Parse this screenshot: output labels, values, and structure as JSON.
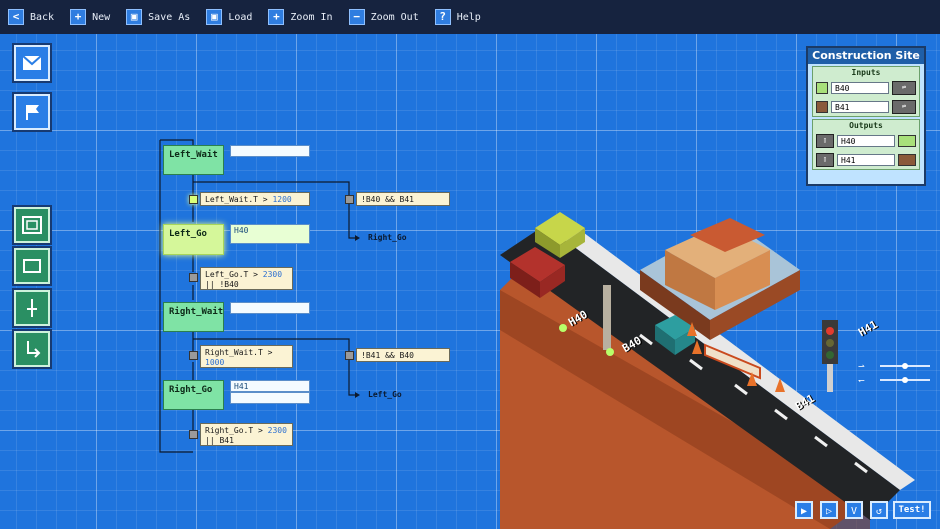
{
  "toolbar": {
    "back": "Back",
    "new": "New",
    "save_as": "Save As",
    "load": "Load",
    "zoom_in": "Zoom In",
    "zoom_out": "Zoom Out",
    "help": "Help"
  },
  "states": {
    "left_wait": "Left_Wait",
    "left_go": "Left_Go",
    "right_wait": "Right_Wait",
    "right_go": "Right_Go"
  },
  "fields": {
    "left_go_out": "H40",
    "right_go_out": "H41"
  },
  "conditions": {
    "c1_text": "Left_Wait.T > ",
    "c1_num": "1200",
    "c2": "!B40 && B41",
    "c3_text": "Left_Go.T > ",
    "c3_num": "2300",
    "c3_line2": "|| !B40",
    "c4_text": "Right_Wait.T >",
    "c4_num": "1000",
    "c5": "!B41 && B40",
    "c6_text": "Right_Go.T > ",
    "c6_num": "2300",
    "c6_line2": "|| B41"
  },
  "targets": {
    "t1": "Right_Go",
    "t2": "Left_Go"
  },
  "panel": {
    "title": "Construction Site",
    "inputs_title": "Inputs",
    "input_1": "B40",
    "input_2": "B41",
    "outputs_title": "Outputs",
    "output_1": "H40",
    "output_2": "H41"
  },
  "scene_labels": {
    "h40": "H40",
    "b40": "B40",
    "b41": "B41",
    "h41": "H41"
  },
  "bottom": {
    "play": "▶",
    "step": "▷",
    "check": "V",
    "reset": "↺",
    "test": "Test!"
  },
  "colors": {
    "grid_bg": "#1f74dd",
    "toolbar_bg": "#16233f",
    "state_green": "#7fe3a5",
    "state_active": "#d5f79a"
  }
}
